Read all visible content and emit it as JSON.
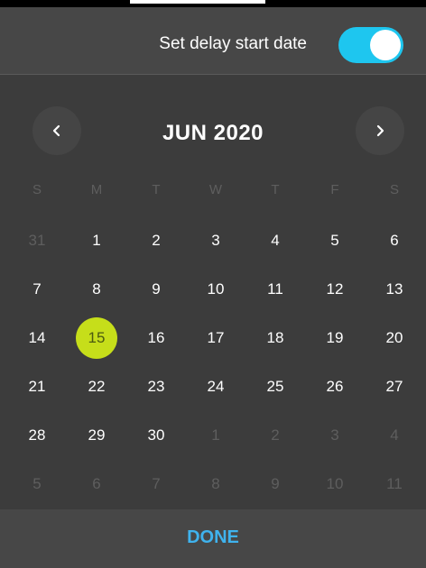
{
  "header": {
    "label": "Set delay start date",
    "toggle_on": true
  },
  "calendar": {
    "month_title": "JUN 2020",
    "weekdays": [
      "S",
      "M",
      "T",
      "W",
      "T",
      "F",
      "S"
    ],
    "weeks": [
      [
        {
          "d": "31",
          "muted": true
        },
        {
          "d": "1"
        },
        {
          "d": "2"
        },
        {
          "d": "3"
        },
        {
          "d": "4"
        },
        {
          "d": "5"
        },
        {
          "d": "6"
        }
      ],
      [
        {
          "d": "7"
        },
        {
          "d": "8"
        },
        {
          "d": "9"
        },
        {
          "d": "10"
        },
        {
          "d": "11"
        },
        {
          "d": "12"
        },
        {
          "d": "13"
        }
      ],
      [
        {
          "d": "14"
        },
        {
          "d": "15",
          "selected": true
        },
        {
          "d": "16"
        },
        {
          "d": "17"
        },
        {
          "d": "18"
        },
        {
          "d": "19"
        },
        {
          "d": "20"
        }
      ],
      [
        {
          "d": "21"
        },
        {
          "d": "22"
        },
        {
          "d": "23"
        },
        {
          "d": "24"
        },
        {
          "d": "25"
        },
        {
          "d": "26"
        },
        {
          "d": "27"
        }
      ],
      [
        {
          "d": "28"
        },
        {
          "d": "29"
        },
        {
          "d": "30"
        },
        {
          "d": "1",
          "muted": true
        },
        {
          "d": "2",
          "muted": true
        },
        {
          "d": "3",
          "muted": true
        },
        {
          "d": "4",
          "muted": true
        }
      ],
      [
        {
          "d": "5",
          "muted": true
        },
        {
          "d": "6",
          "muted": true
        },
        {
          "d": "7",
          "muted": true
        },
        {
          "d": "8",
          "muted": true
        },
        {
          "d": "9",
          "muted": true
        },
        {
          "d": "10",
          "muted": true
        },
        {
          "d": "11",
          "muted": true
        }
      ]
    ]
  },
  "footer": {
    "done_label": "DONE"
  },
  "colors": {
    "toggle_accent": "#1ec6ef",
    "selected_day": "#c6de1a",
    "done_text": "#3fb3ee",
    "panel_bg": "#3c3c3c"
  },
  "icons": {
    "prev": "chevron-left-icon",
    "next": "chevron-right-icon"
  }
}
